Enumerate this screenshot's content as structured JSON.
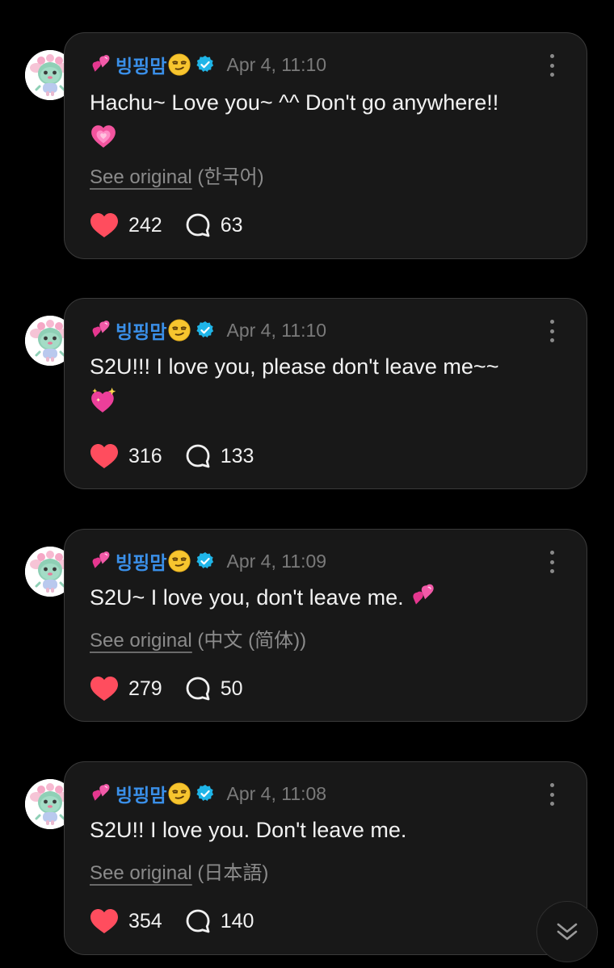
{
  "posts": [
    {
      "username": "빙핑맘",
      "timestamp": "Apr 4, 11:10",
      "text": "Hachu~ Love you~ ^^ Don't go anywhere!!",
      "trailing_emoji": "growing-heart",
      "see_original_label": "See original",
      "original_language": "(한국어)",
      "likes": "242",
      "comments": "63"
    },
    {
      "username": "빙핑맘",
      "timestamp": "Apr 4, 11:10",
      "text": "S2U!!! I love you, please don't leave me~~",
      "trailing_emoji": "sparkling-heart",
      "likes": "316",
      "comments": "133"
    },
    {
      "username": "빙핑맘",
      "timestamp": "Apr 4, 11:09",
      "text": "S2U~ I love you, don't leave me.",
      "trailing_emoji": "two-hearts",
      "see_original_label": "See original",
      "original_language": "(中文 (简体))",
      "likes": "279",
      "comments": "50"
    },
    {
      "username": "빙핑맘",
      "timestamp": "Apr 4, 11:08",
      "text": "S2U!! I love you. Don't leave me.",
      "see_original_label": "See original",
      "original_language": "(日本語)",
      "likes": "354",
      "comments": "140"
    }
  ],
  "icons": {
    "name_prefix_emoji": "two-hearts",
    "name_suffix_emoji": "smirking-face",
    "verified": "verified-badge-icon",
    "like": "heart-icon",
    "comment": "comment-bubble-icon",
    "more": "more-options-icon",
    "scroll": "double-chevron-down-icon"
  },
  "colors": {
    "background": "#000000",
    "card": "#181818",
    "username": "#3a8fe8",
    "verified": "#1fb5e8",
    "like": "#ff4d5e",
    "muted": "#7a7a7a"
  }
}
